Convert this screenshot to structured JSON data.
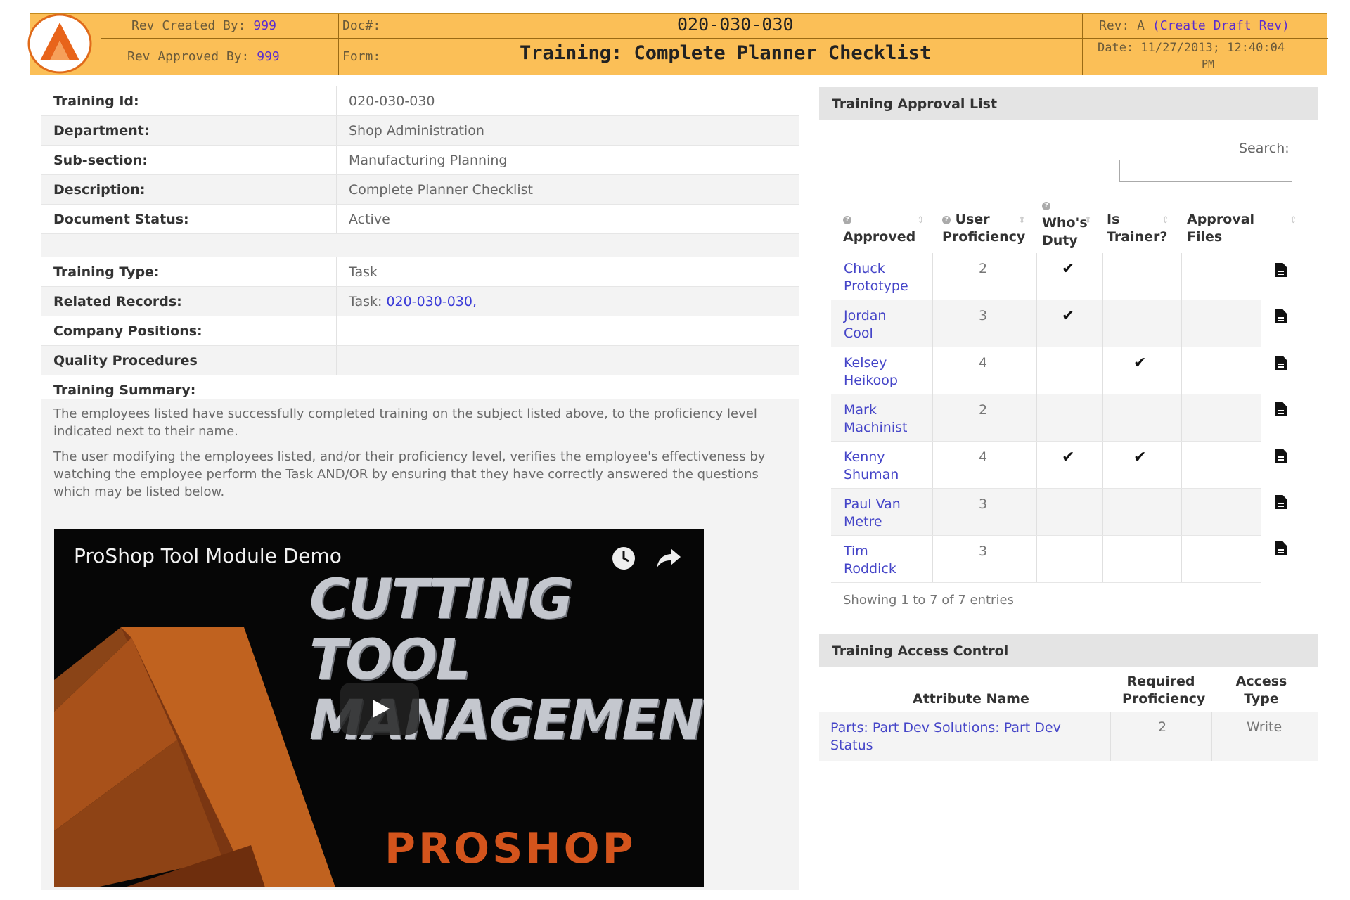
{
  "header": {
    "rev_created_label": "Rev Created By:",
    "rev_created_value": "999",
    "rev_approved_label": "Rev Approved By:",
    "rev_approved_value": "999",
    "doc_label": "Doc#:",
    "form_label": "Form:",
    "doc_number": "020-030-030",
    "title": "Training: Complete Planner Checklist",
    "rev_label": "Rev: A",
    "create_draft": "(Create Draft Rev)",
    "date_label": "Date: 11/27/2013; 12:40:04",
    "date_pm": "PM"
  },
  "info": {
    "training_id_label": "Training Id:",
    "training_id": "020-030-030",
    "department_label": "Department:",
    "department": "Shop Administration",
    "subsection_label": "Sub-section:",
    "subsection": "Manufacturing Planning",
    "description_label": "Description:",
    "description": "Complete Planner Checklist",
    "status_label": "Document Status:",
    "status": "Active",
    "training_type_label": "Training Type:",
    "training_type": "Task",
    "related_label": "Related Records:",
    "related_prefix": "Task:",
    "related_link": "020-030-030,",
    "positions_label": "Company Positions:",
    "procedures_label": "Quality Procedures",
    "summary_label": "Training Summary:"
  },
  "summary": {
    "p1": "The employees listed have successfully completed training on the subject listed above, to the proficiency level indicated next to their name.",
    "p2": "The user modifying the employees listed, and/or their proficiency level, verifies the employee's effectiveness by watching the employee perform the Task AND/OR by ensuring that they have correctly answered the questions which may be listed below."
  },
  "video": {
    "title": "ProShop Tool Module Demo",
    "line1": "CUTTING TOOL",
    "line2": "MANAGEMENT",
    "brand": "PROSHOP"
  },
  "approval": {
    "heading": "Training Approval List",
    "search_label": "Search:",
    "col_approved": "Approved",
    "col_user": "User",
    "col_proficiency": "Proficiency",
    "col_whos": "Who's",
    "col_duty": "Duty",
    "col_is": "Is",
    "col_trainer": "Trainer?",
    "col_approval": "Approval",
    "col_files": "Files",
    "check": "✔",
    "rows": [
      {
        "first": "Chuck",
        "last": "Prototype",
        "prof": "2",
        "duty": true,
        "trainer": false
      },
      {
        "first": "Jordan",
        "last": "Cool",
        "prof": "3",
        "duty": true,
        "trainer": false
      },
      {
        "first": "Kelsey",
        "last": "Heikoop",
        "prof": "4",
        "duty": false,
        "trainer": true
      },
      {
        "first": "Mark",
        "last": "Machinist",
        "prof": "2",
        "duty": false,
        "trainer": false
      },
      {
        "first": "Kenny",
        "last": "Shuman",
        "prof": "4",
        "duty": true,
        "trainer": true
      },
      {
        "first": "Paul Van",
        "last": "Metre",
        "prof": "3",
        "duty": false,
        "trainer": false
      },
      {
        "first": "Tim",
        "last": "Roddick",
        "prof": "3",
        "duty": false,
        "trainer": false
      }
    ],
    "entries": "Showing 1 to 7 of 7 entries"
  },
  "access": {
    "heading": "Training Access Control",
    "col_attr": "Attribute Name",
    "col_req1": "Required",
    "col_req2": "Proficiency",
    "col_acc1": "Access",
    "col_acc2": "Type",
    "row_attr1": "Parts: Part Dev Solutions: Part Dev",
    "row_attr2": "Status",
    "row_prof": "2",
    "row_type": "Write"
  },
  "colors": {
    "header_bg": "#fbbf57",
    "link": "#3b3bd8",
    "brand": "#d3541c"
  },
  "icons": [
    "logo-icon",
    "clock-icon",
    "share-icon",
    "play-icon",
    "file-icon",
    "sort-icon",
    "help-icon"
  ]
}
